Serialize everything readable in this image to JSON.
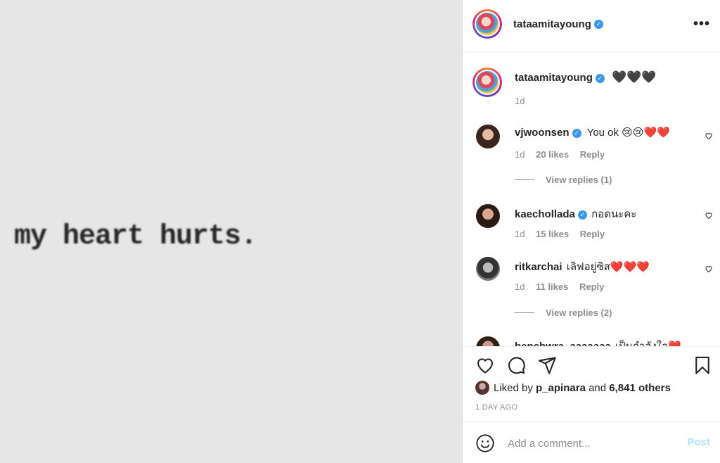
{
  "media": {
    "text": "my heart hurts."
  },
  "header": {
    "username": "tataamitayoung",
    "verified_mark": "✓",
    "more_icon": "more-horizontal-icon"
  },
  "caption": {
    "username": "tataamitayoung",
    "text": "🖤🖤🖤",
    "time": "1d"
  },
  "comments": [
    {
      "username": "vjwoonsen",
      "verified": true,
      "text": "You ok 😢😢❤️❤️",
      "time": "1d",
      "likes": "20 likes",
      "reply": "Reply",
      "view_replies": "View replies (1)"
    },
    {
      "username": "kaechollada",
      "verified": true,
      "text": "กอดนะคะ",
      "time": "1d",
      "likes": "15 likes",
      "reply": "Reply"
    },
    {
      "username": "ritkarchai",
      "verified": false,
      "text": "เลิฟอยู่ซิส❤️❤️❤️",
      "time": "1d",
      "likes": "11 likes",
      "reply": "Reply",
      "view_replies": "View replies (2)"
    },
    {
      "username": "benchwra_aaaaaaa",
      "text": "เป็นกำลังใจ❤️"
    }
  ],
  "actions": {
    "icons": [
      "heart-icon",
      "comment-icon",
      "share-icon",
      "bookmark-icon"
    ],
    "liked_by_prefix": "Liked by",
    "liked_by_user": "p_apinara",
    "liked_by_and": "and",
    "liked_by_others": "6,841 others",
    "time_ago": "1 DAY AGO"
  },
  "add_comment": {
    "placeholder": "Add a comment...",
    "post_label": "Post"
  },
  "colors": {
    "verified": "#3897f0",
    "link_disabled": "#b2dffc",
    "muted": "#8e8e8e"
  }
}
